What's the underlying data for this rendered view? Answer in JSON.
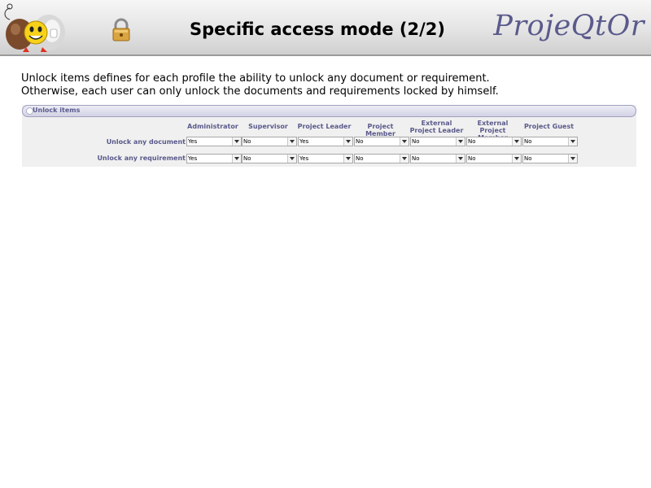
{
  "header": {
    "title": "Specific access mode (2/2)",
    "brand": "ProjeQtOr"
  },
  "intro": {
    "line1": "Unlock items defines for each profile the ability to unlock any document or requirement.",
    "line2": "Otherwise, each user can only unlock the documents and requirements locked by himself."
  },
  "section": {
    "title": "Unlock items",
    "columns": [
      [
        "Administrator"
      ],
      [
        "Supervisor"
      ],
      [
        "Project Leader"
      ],
      [
        "Project Member"
      ],
      [
        "External",
        "Project Leader"
      ],
      [
        "External",
        "Project Member"
      ],
      [
        "Project Guest"
      ]
    ],
    "rows": [
      {
        "label": "Unlock any document",
        "values": [
          "Yes",
          "No",
          "Yes",
          "No",
          "No",
          "No",
          "No"
        ]
      },
      {
        "label": "Unlock any requirement",
        "values": [
          "Yes",
          "No",
          "Yes",
          "No",
          "No",
          "No",
          "No"
        ]
      }
    ]
  }
}
